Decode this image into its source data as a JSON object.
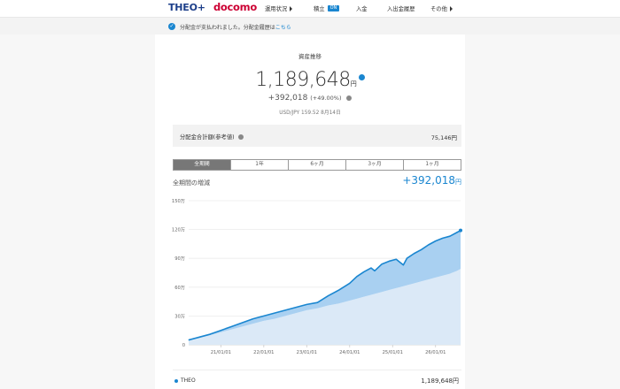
{
  "header": {
    "logo_theo": "THEO+",
    "logo_docomo": "docomo",
    "nav": [
      {
        "label": "運用状況",
        "has_arrow": true
      },
      {
        "label": "積立",
        "badge": "ON"
      },
      {
        "label": "入金"
      },
      {
        "label": "入出金履歴"
      },
      {
        "label": "その他",
        "has_arrow": true
      }
    ]
  },
  "notice": {
    "text": "分配金が支払われました。分配金履歴は",
    "link": "こちら"
  },
  "summary": {
    "title": "資産推移",
    "total_value": "1,189,648",
    "total_unit": "円",
    "gain": "+392,018",
    "gain_pct": "(+49.00%)",
    "fx_note": "USD/JPY 159.52 8月14日"
  },
  "dividend": {
    "label": "分配金合計額(参考値)",
    "value": "75,146円"
  },
  "tabs": [
    "全期間",
    "1年",
    "6ヶ月",
    "3ヶ月",
    "1ヶ月"
  ],
  "active_tab": 0,
  "period": {
    "label": "全期間の増減",
    "value": "+392,018",
    "unit": "円"
  },
  "legend": {
    "name": "THEO",
    "value": "1,189,648円"
  },
  "colors": {
    "accent": "#1a86d0",
    "brand_theo": "#1d3f8a",
    "brand_docomo": "#cc0033"
  },
  "chart_data": {
    "type": "area",
    "y_tick_labels": [
      "0",
      "30万",
      "60万",
      "90万",
      "120万",
      "150万"
    ],
    "x_tick_labels": [
      "21/01/01",
      "22/01/01",
      "23/01/01",
      "24/01/01",
      "25/01/01",
      "26/01/01"
    ],
    "ylim": [
      0,
      150
    ],
    "y_unit": "万円",
    "grid": true,
    "x": [
      "2020-04",
      "2020-07",
      "2020-10",
      "2021-01",
      "2021-04",
      "2021-07",
      "2021-10",
      "2022-01",
      "2022-04",
      "2022-07",
      "2022-10",
      "2023-01",
      "2023-04",
      "2023-07",
      "2023-10",
      "2024-01",
      "2024-03",
      "2024-05",
      "2024-07",
      "2024-08",
      "2024-10",
      "2024-12",
      "2025-02",
      "2025-04",
      "2025-05",
      "2025-07",
      "2025-09",
      "2025-11",
      "2026-01",
      "2026-03",
      "2026-05",
      "2026-07",
      "2026-08"
    ],
    "series": [
      {
        "name": "THEO",
        "values": [
          5,
          8,
          11,
          15,
          19,
          23,
          27,
          30,
          33,
          36,
          39,
          42,
          44,
          51,
          57,
          64,
          71,
          76,
          80,
          77,
          84,
          87,
          89,
          83,
          90,
          95,
          99,
          104,
          108,
          111,
          113,
          117,
          119
        ]
      },
      {
        "values": [
          5,
          7,
          10,
          13,
          16,
          19,
          22,
          25,
          27,
          30,
          33,
          36,
          38,
          41,
          43,
          46,
          48,
          50,
          52,
          53,
          55,
          57,
          59,
          61,
          62,
          64,
          66,
          68,
          70,
          72,
          74,
          77,
          79
        ]
      }
    ]
  }
}
